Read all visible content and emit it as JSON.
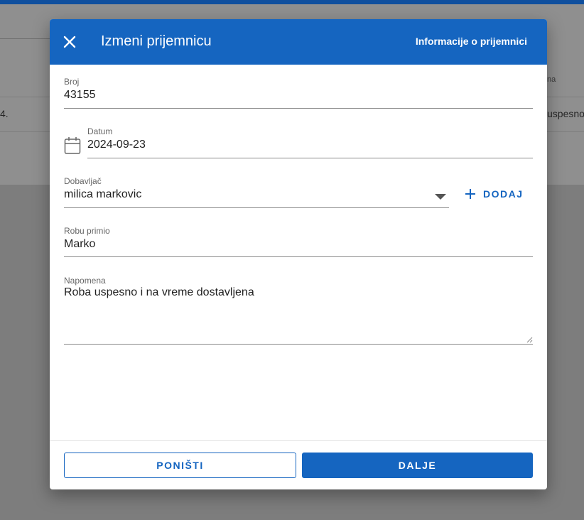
{
  "background": {
    "row_fragment_left": "4.",
    "row_fragment_right": "uspesno i",
    "header_fragment_right": "na"
  },
  "dialog": {
    "title": "Izmeni prijemnicu",
    "info_link": "Informacije o prijemnici",
    "close_icon": "close-icon",
    "fields": {
      "broj": {
        "label": "Broj",
        "value": "43155"
      },
      "datum": {
        "label": "Datum",
        "value": "2024-09-23",
        "icon": "calendar-icon"
      },
      "dobavljac": {
        "label": "Dobavljač",
        "value": "milica markovic",
        "icon": "chevron-down-icon"
      },
      "robu_primio": {
        "label": "Robu primio",
        "value": "Marko"
      },
      "napomena": {
        "label": "Napomena",
        "value": "Roba uspesno i na vreme dostavljena"
      }
    },
    "add_button": {
      "label": "DODAJ",
      "icon": "plus-icon"
    },
    "cancel_button": "PONIŠTI",
    "next_button": "DALJE"
  },
  "colors": {
    "primary": "#1565c0",
    "overlay": "#7d7d7d"
  }
}
